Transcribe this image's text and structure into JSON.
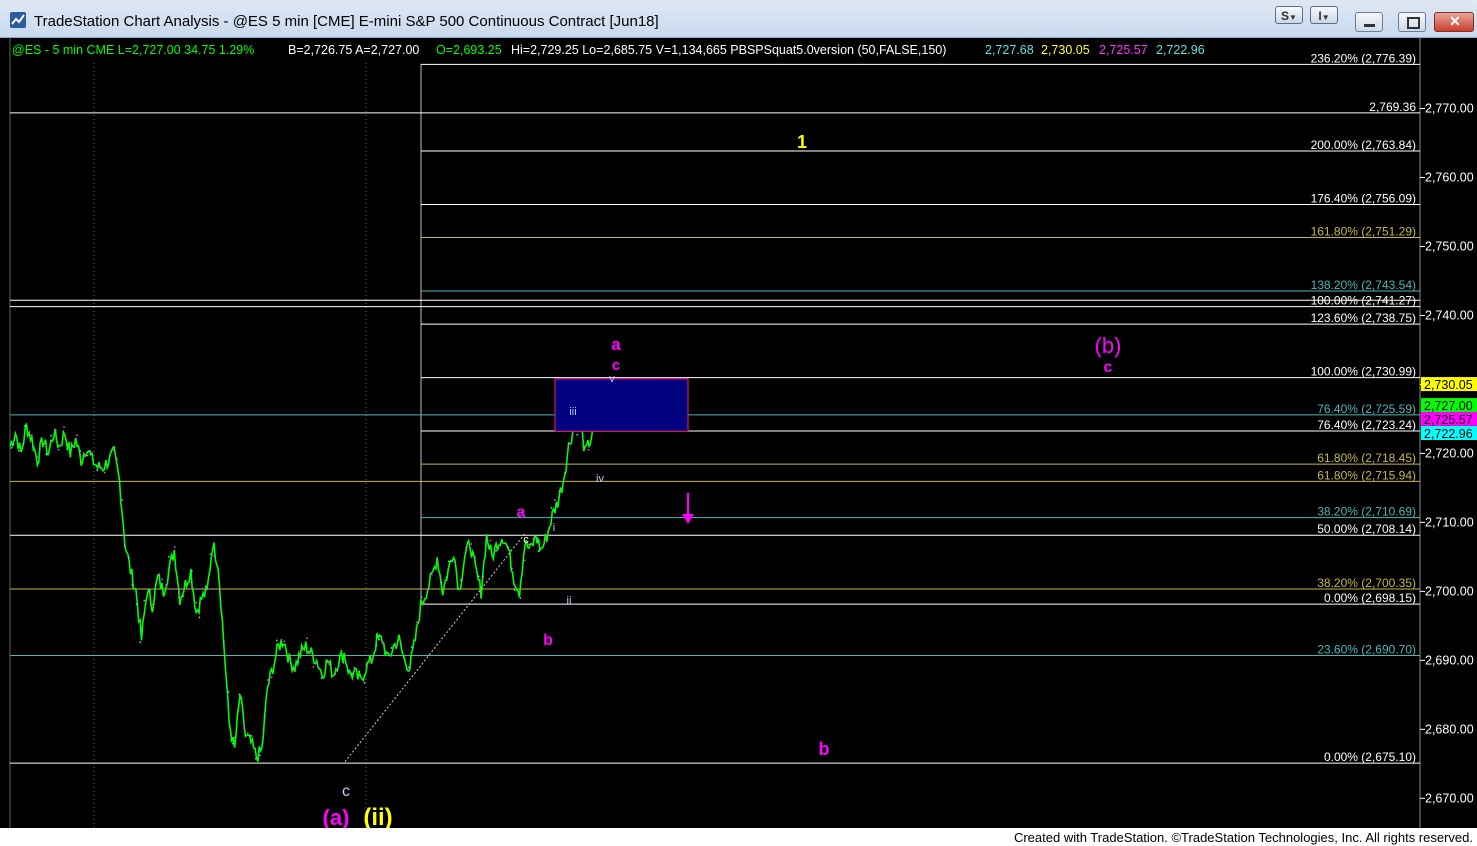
{
  "window": {
    "title": "TradeStation Chart Analysis - @ES 5 min [CME] E-mini S&P 500 Continuous Contract [Jun18]",
    "btn_s": "S",
    "btn_i": "I"
  },
  "footer": "Created with TradeStation. ©TradeStation Technologies, Inc. All rights reserved.",
  "colors": {
    "price": "#00ff00",
    "wave_magenta": "#ff00ff",
    "wave_yellow": "#ffff00",
    "axis_bg": "#000000",
    "box_fill": "#000080"
  },
  "header": {
    "segments": [
      {
        "text": "@ES - 5 min  CME  L=2,727.00  34.75  1.29%",
        "color": "#00ff00"
      },
      {
        "text": "B=2,726.75  A=2,727.00",
        "color": "#ffffff"
      },
      {
        "text": "O=2,693.25",
        "color": "#00ff00"
      },
      {
        "text": "Hi=2,729.25  Lo=2,685.75  V=1,134,665  PBSPSquat5.0version (50,FALSE,150)",
        "color": "#ffffff"
      },
      {
        "text": "2,727.68",
        "color": "#5fe0e0"
      },
      {
        "text": "2,730.05",
        "color": "#ffff33"
      },
      {
        "text": "2,725.57",
        "color": "#ff33ff"
      },
      {
        "text": "2,722.96",
        "color": "#5fe0e0"
      }
    ]
  },
  "chart_data": {
    "type": "line",
    "title": "",
    "xlabel": "",
    "ylabel": "",
    "ylim": [
      2667,
      2780
    ],
    "y_ticks": [
      "2,770.00",
      "2,760.00",
      "2,750.00",
      "2,740.00",
      "2,730.00",
      "2,720.00",
      "2,710.00",
      "2,700.00",
      "2,690.00",
      "2,680.00",
      "2,670.00"
    ],
    "y_tick_values": [
      2770,
      2760,
      2750,
      2740,
      2730,
      2720,
      2710,
      2700,
      2690,
      2680,
      2670
    ],
    "series": [
      {
        "values": [
          2721,
          2723,
          2720,
          2724,
          2722,
          2719,
          2722,
          2720,
          2723,
          2721,
          2723,
          2720,
          2722,
          2719,
          2721,
          2719,
          2718,
          2718,
          2719,
          2720,
          2716,
          2707,
          2703,
          2700,
          2693,
          2700,
          2698,
          2702,
          2700,
          2703,
          2706,
          2699,
          2701,
          2703,
          2697,
          2699,
          2700,
          2707,
          2704,
          2693,
          2681,
          2677,
          2685,
          2679,
          2678,
          2676,
          2677,
          2686,
          2689,
          2692,
          2693,
          2690,
          2689,
          2691,
          2692,
          2691,
          2690,
          2688,
          2690,
          2688,
          2690,
          2691,
          2688,
          2688,
          2687,
          2689,
          2690,
          2693,
          2693,
          2690,
          2692,
          2693,
          2690,
          2689,
          2693,
          2698,
          2700,
          2702,
          2705,
          2700,
          2703,
          2706,
          2700,
          2705,
          2707,
          2703,
          2700,
          2708,
          2705,
          2707,
          2708,
          2706,
          2702,
          2700,
          2707,
          2706,
          2708,
          2706,
          2708,
          2711,
          2713,
          2716,
          2721,
          2724,
          2725,
          2720,
          2722,
          2726,
          2728,
          2727,
          2729,
          2727
        ]
      }
    ],
    "horizontal_levels": [
      {
        "label": "236.20% (2,776.39)",
        "value": 2776.39,
        "color": "#ffffff"
      },
      {
        "label": "2,769.36",
        "value": 2769.36,
        "color": "#ffffff"
      },
      {
        "label": "200.00% (2,763.84)",
        "value": 2763.84,
        "color": "#ffffff"
      },
      {
        "label": "176.40% (2,756.09)",
        "value": 2756.09,
        "color": "#ffffff"
      },
      {
        "label": "161.80% (2,751.29)",
        "value": 2751.29,
        "color": "#c8b84b"
      },
      {
        "label": "138.20% (2,743.54)",
        "value": 2743.54,
        "color": "#4bb7b7"
      },
      {
        "label": "100.00% (2,741.27)",
        "value": 2741.27,
        "color": "#ffffff"
      },
      {
        "label": "123.60% (2,738.75)",
        "value": 2738.75,
        "color": "#ffffff"
      },
      {
        "label": "100.00% (2,730.99)",
        "value": 2730.99,
        "color": "#ffffff"
      },
      {
        "label": "76.40% (2,725.59)",
        "value": 2725.59,
        "color": "#4bb7b7"
      },
      {
        "label": "76.40% (2,723.24)",
        "value": 2723.24,
        "color": "#ffffff"
      },
      {
        "label": "61.80% (2,718.45)",
        "value": 2718.45,
        "color": "#c8b84b"
      },
      {
        "label": "61.80% (2,715.94)",
        "value": 2715.94,
        "color": "#c8b84b"
      },
      {
        "label": "38.20% (2,710.69)",
        "value": 2710.69,
        "color": "#4bb7b7"
      },
      {
        "label": "50.00% (2,708.14)",
        "value": 2708.14,
        "color": "#ffffff"
      },
      {
        "label": "38.20% (2,700.35)",
        "value": 2700.35,
        "color": "#c8b84b"
      },
      {
        "label": "0.00% (2,698.15)",
        "value": 2698.15,
        "color": "#ffffff"
      },
      {
        "label": "23.60% (2,690.70)",
        "value": 2690.7,
        "color": "#4bb7b7"
      },
      {
        "label": "0.00% (2,675.10)",
        "value": 2675.1,
        "color": "#ffffff"
      }
    ],
    "price_tags": [
      {
        "label": "2,730.05",
        "value": 2730.05,
        "bg": "#ffff00",
        "fg": "#000000"
      },
      {
        "label": "2,727.00",
        "value": 2727.0,
        "bg": "#00ff00",
        "fg": "#000000"
      },
      {
        "label": "2,725.57",
        "value": 2725.0,
        "bg": "#ff00ff",
        "fg": "#000000"
      },
      {
        "label": "2,722.96",
        "value": 2722.96,
        "bg": "#00ffff",
        "fg": "#000000"
      }
    ],
    "wave_labels": [
      {
        "text": "1",
        "color": "#ffff00"
      },
      {
        "text": "a",
        "color": "#ff00ff"
      },
      {
        "text": "c",
        "color": "#ff00ff"
      },
      {
        "text": "v",
        "color": "#c0c8ff"
      },
      {
        "text": "iii",
        "color": "#c0c8ff"
      },
      {
        "text": "iv",
        "color": "#c0c8ff"
      },
      {
        "text": "(b)",
        "color": "#ff00ff"
      },
      {
        "text": "c",
        "color": "#ff00ff"
      },
      {
        "text": "a",
        "color": "#ff00ff"
      },
      {
        "text": "c",
        "color": "#ffffff"
      },
      {
        "text": "i",
        "color": "#c0c8ff"
      },
      {
        "text": "ii",
        "color": "#c0c8ff"
      },
      {
        "text": "b",
        "color": "#ff00ff"
      },
      {
        "text": "b",
        "color": "#ff00ff"
      },
      {
        "text": "c",
        "color": "#c0c8ff"
      },
      {
        "text": "(a)",
        "color": "#ff00ff"
      },
      {
        "text": "(ii)",
        "color": "#ffff00"
      }
    ]
  }
}
